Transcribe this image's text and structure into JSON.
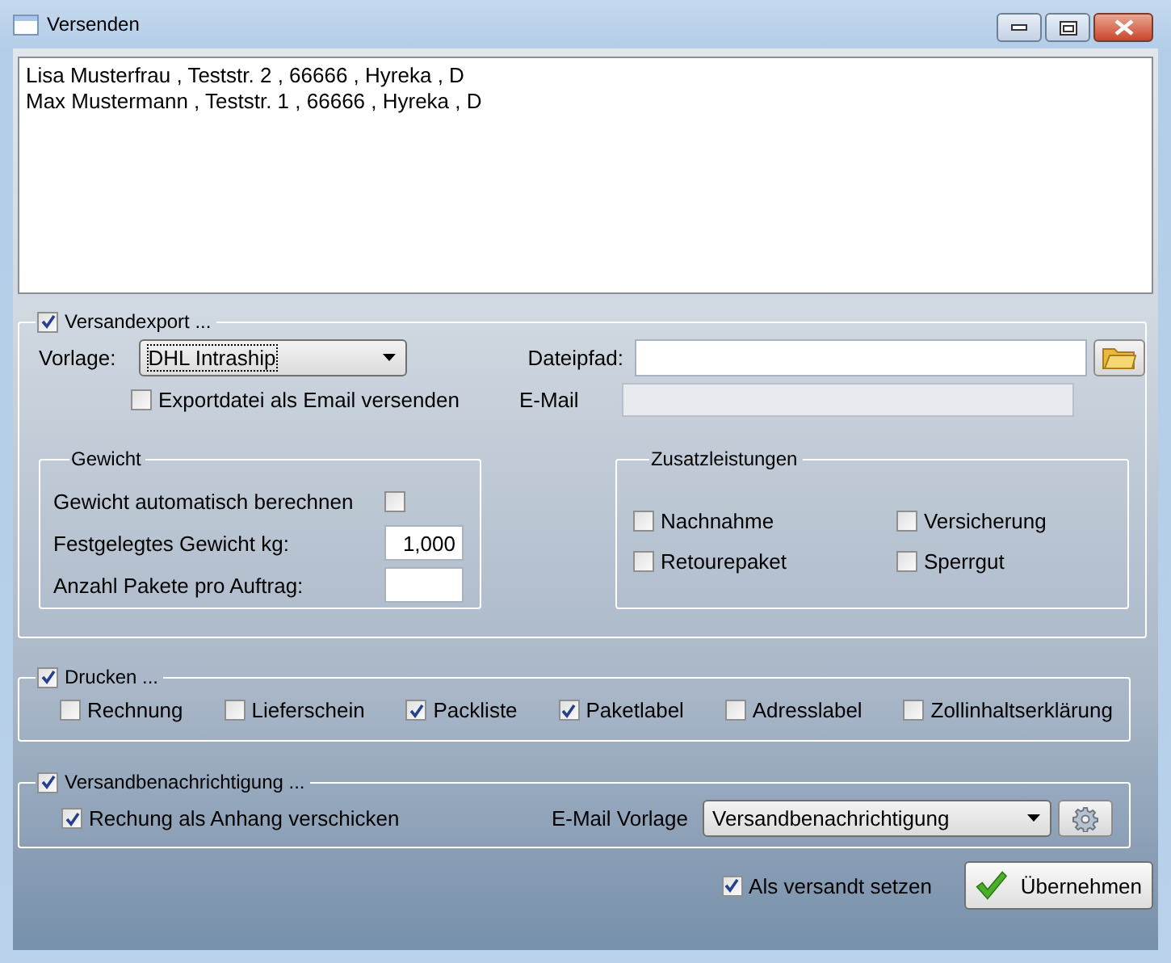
{
  "window": {
    "title": "Versenden"
  },
  "recipients": [
    "Lisa Musterfrau , Teststr. 2 , 66666 , Hyreka , D",
    "Max Mustermann , Teststr. 1 , 66666 , Hyreka , D"
  ],
  "versandexport": {
    "label": "Versandexport ...",
    "checked": true,
    "vorlage_label": "Vorlage:",
    "vorlage_value": "DHL Intraship",
    "dateipfad_label": "Dateipfad:",
    "email_label": "E-Mail",
    "export_email": {
      "label": "Exportdatei als Email versenden",
      "checked": false
    },
    "gewicht": {
      "title": "Gewicht",
      "auto_label": "Gewicht automatisch berechnen",
      "auto_checked": false,
      "fixed_label": "Festgelegtes Gewicht kg:",
      "fixed_value": "1,000",
      "pakete_label": "Anzahl Pakete pro Auftrag:"
    },
    "zusatz": {
      "title": "Zusatzleistungen",
      "options": [
        {
          "label": "Nachnahme",
          "checked": false
        },
        {
          "label": "Versicherung",
          "checked": false
        },
        {
          "label": "Retourepaket",
          "checked": false
        },
        {
          "label": "Sperrgut",
          "checked": false
        }
      ]
    }
  },
  "drucken": {
    "label": "Drucken ...",
    "checked": true,
    "options": [
      {
        "label": "Rechnung",
        "checked": false
      },
      {
        "label": "Lieferschein",
        "checked": false
      },
      {
        "label": "Packliste",
        "checked": true
      },
      {
        "label": "Paketlabel",
        "checked": true
      },
      {
        "label": "Adresslabel",
        "checked": false
      },
      {
        "label": "Zollinhaltserklärung",
        "checked": false
      }
    ]
  },
  "benachrichtigung": {
    "label": "Versandbenachrichtigung ...",
    "checked": true,
    "anhang": {
      "label": "Rechung als Anhang verschicken",
      "checked": true
    },
    "vorlage_label": "E-Mail Vorlage",
    "vorlage_value": "Versandbenachrichtigung"
  },
  "als_versandt": {
    "label": "Als versandt setzen",
    "checked": true
  },
  "submit_button": "Übernehmen"
}
